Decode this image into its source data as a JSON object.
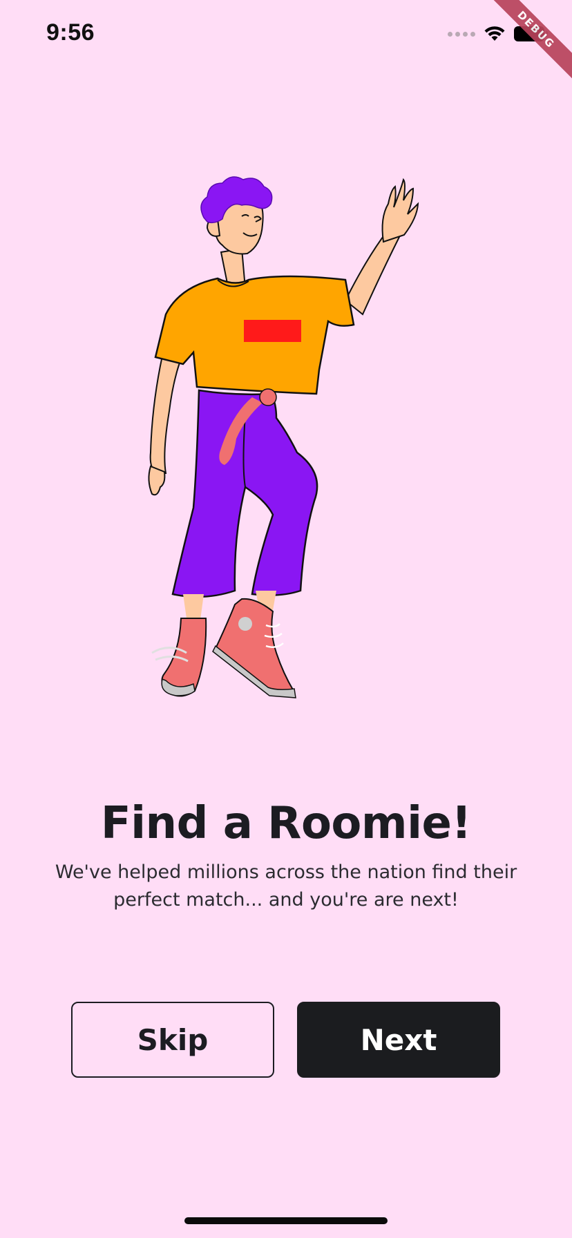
{
  "status_bar": {
    "time": "9:56",
    "icons": [
      "signal-dots-icon",
      "wifi-icon",
      "battery-icon"
    ]
  },
  "debug_banner": "DEBUG",
  "onboarding": {
    "title": "Find a Roomie!",
    "subtitle": "We've helped millions across the nation find their perfect match... and you're are next!",
    "illustration": "waving-person-illustration"
  },
  "actions": {
    "skip_label": "Skip",
    "next_label": "Next"
  },
  "colors": {
    "background": "#FFDDF6",
    "primary_button": "#1B1C1F",
    "text": "#1C1C22",
    "hair": "#8A16F3",
    "shirt": "#FFA500",
    "pants": "#8A16F3",
    "shoes": "#F07070"
  }
}
